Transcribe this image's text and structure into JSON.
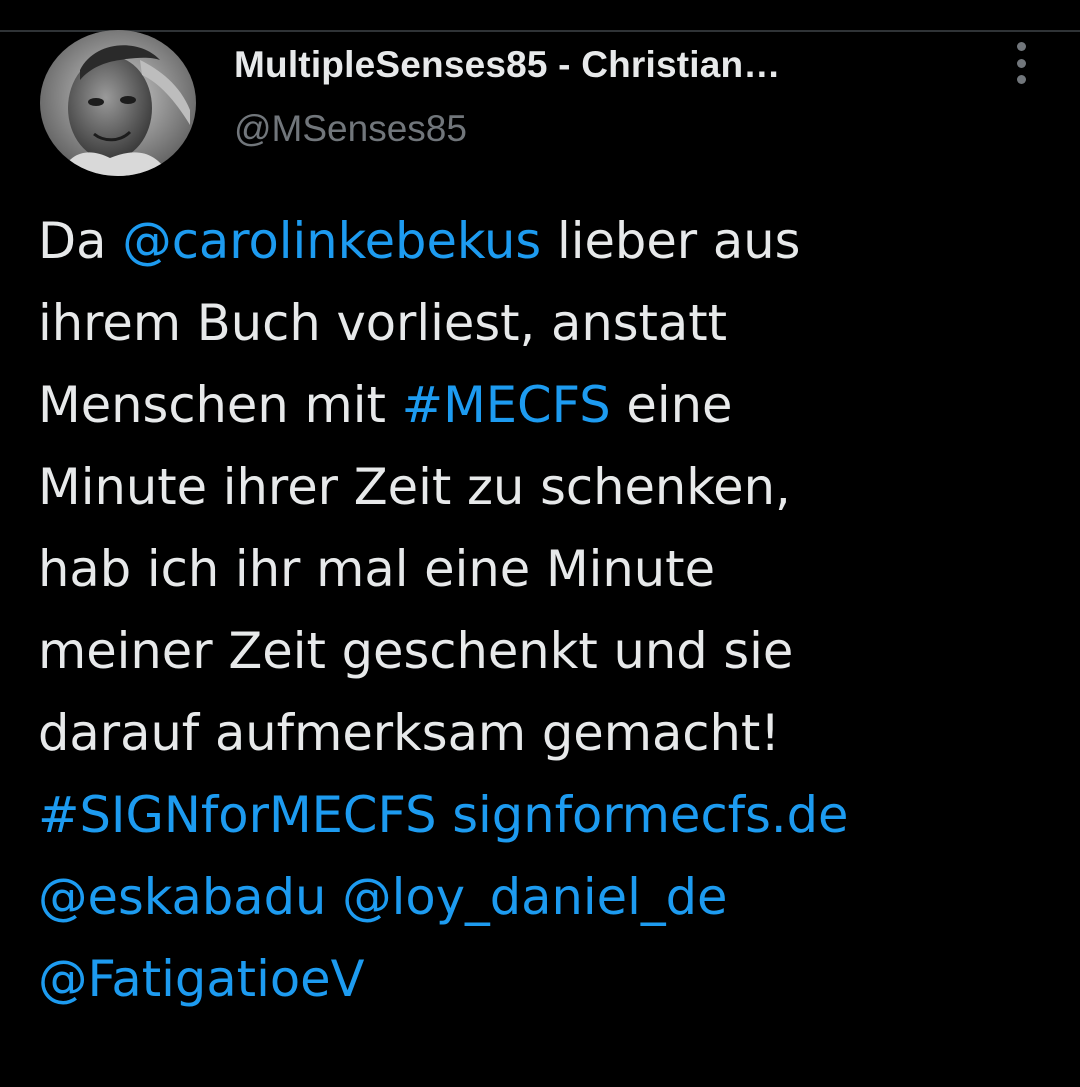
{
  "colors": {
    "background": "#000000",
    "text": "#e7e9ea",
    "secondary": "#71767b",
    "link": "#1d9bf0"
  },
  "author": {
    "display_name": "MultipleSenses85 - Christian…",
    "handle": "@MSenses85",
    "avatar": "profile-photo"
  },
  "more_menu": {
    "icon": "more-vertical-icon"
  },
  "tweet": {
    "l1_a": "Da ",
    "l1_mention": "@carolinkebekus",
    "l1_b": " lieber aus",
    "l2": "ihrem Buch vorliest, anstatt",
    "l3_a": "Menschen mit ",
    "l3_hashtag": "#MECFS",
    "l3_b": " eine",
    "l4": "Minute ihrer Zeit zu schenken,",
    "l5": "hab ich ihr mal eine Minute",
    "l6": "meiner Zeit geschenkt und sie",
    "l7": "darauf aufmerksam gemacht!",
    "l8_hashtag": "#SIGNforMECFS",
    "l8_space": " ",
    "l8_url": "signformecfs.de",
    "l9_mention1": "@eskabadu",
    "l9_space": " ",
    "l9_mention2": "@loy_daniel_de",
    "l10_mention": "@FatigatioeV"
  }
}
